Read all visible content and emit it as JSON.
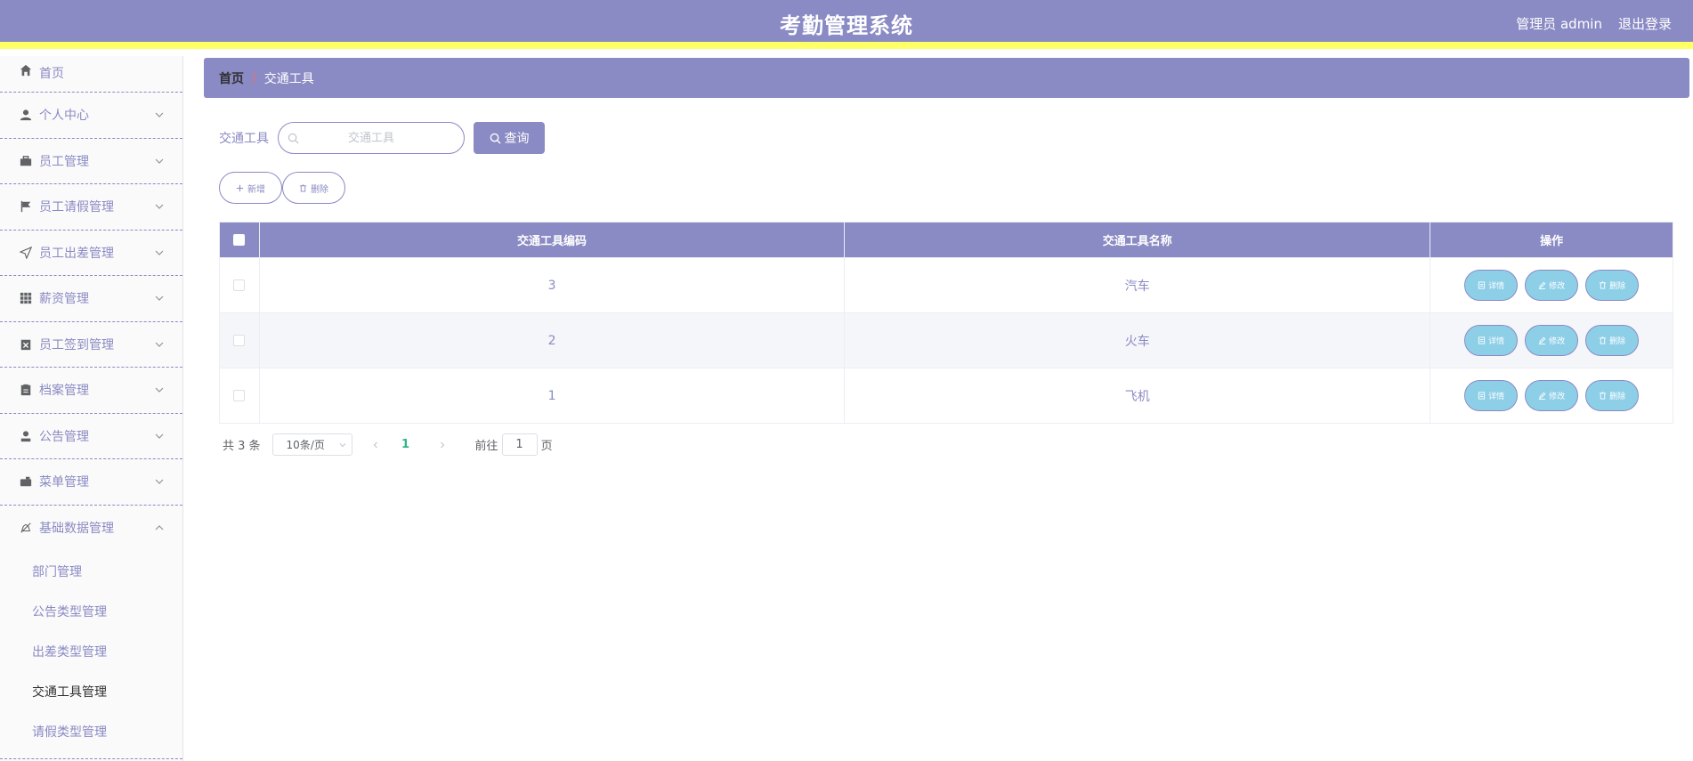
{
  "header": {
    "title": "考勤管理系统",
    "user": "管理员 admin",
    "logout": "退出登录"
  },
  "sidebar": {
    "items": [
      {
        "label": "首页",
        "icon": "home-icon"
      },
      {
        "label": "个人中心",
        "icon": "user-icon"
      },
      {
        "label": "员工管理",
        "icon": "briefcase-icon"
      },
      {
        "label": "员工请假管理",
        "icon": "flag-icon"
      },
      {
        "label": "员工出差管理",
        "icon": "send-icon"
      },
      {
        "label": "薪资管理",
        "icon": "grid-icon"
      },
      {
        "label": "员工签到管理",
        "icon": "clipboard-icon"
      },
      {
        "label": "档案管理",
        "icon": "document-icon"
      },
      {
        "label": "公告管理",
        "icon": "person-icon"
      },
      {
        "label": "菜单管理",
        "icon": "wallet-icon"
      },
      {
        "label": "基础数据管理",
        "icon": "bell-off-icon"
      }
    ],
    "subitems": [
      "部门管理",
      "公告类型管理",
      "出差类型管理",
      "交通工具管理",
      "请假类型管理"
    ]
  },
  "breadcrumb": {
    "home": "首页",
    "separator": "/",
    "current": "交通工具"
  },
  "search": {
    "label": "交通工具",
    "placeholder": "交通工具",
    "button": "查询"
  },
  "actions": {
    "add": "新增",
    "delete": "删除"
  },
  "table": {
    "columns": [
      "交通工具编码",
      "交通工具名称",
      "操作"
    ],
    "rows": [
      {
        "code": "3",
        "name": "汽车"
      },
      {
        "code": "2",
        "name": "火车"
      },
      {
        "code": "1",
        "name": "飞机"
      }
    ],
    "ops": {
      "detail": "详情",
      "edit": "修改",
      "delete": "删除"
    }
  },
  "pagination": {
    "total": "共 3 条",
    "page_size": "10条/页",
    "current": "1",
    "goto": "前往",
    "goto_value": "1",
    "page_unit": "页"
  },
  "colors": {
    "primary": "#8a8ac4",
    "accent_stripe": "#ffff66",
    "op_button": "#8ecfe8",
    "active_page": "#2fb585"
  }
}
